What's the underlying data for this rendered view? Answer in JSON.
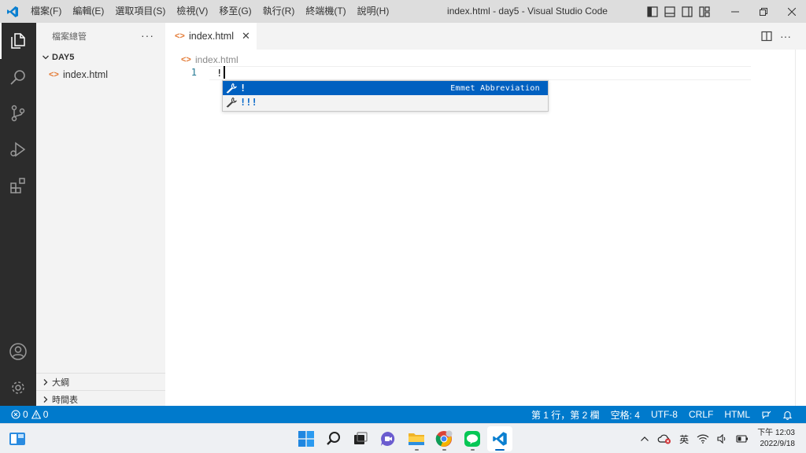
{
  "titlebar": {
    "menu": [
      "檔案(F)",
      "編輯(E)",
      "選取項目(S)",
      "檢視(V)",
      "移至(G)",
      "執行(R)",
      "終端機(T)",
      "說明(H)"
    ],
    "title": "index.html - day5 - Visual Studio Code",
    "accent": "#007acc"
  },
  "sidebar": {
    "header": "檔案總管",
    "more": "···",
    "folder": "DAY5",
    "files": [
      {
        "name": "index.html",
        "icon": "html-file-icon"
      }
    ],
    "outline": "大綱",
    "timeline": "時間表"
  },
  "tabs": [
    {
      "label": "index.html",
      "icon": "html-file-icon",
      "active": true
    }
  ],
  "editor": {
    "breadcrumb": "index.html",
    "line_number": "1",
    "code": "!"
  },
  "suggest": {
    "items": [
      {
        "label": "!",
        "detail": "Emmet Abbreviation",
        "selected": true,
        "icon": "wrench-icon"
      },
      {
        "label": "!!!",
        "detail": "",
        "selected": false,
        "icon": "wrench-icon"
      }
    ],
    "selected_bg": "#0060c0"
  },
  "statusbar": {
    "errors": "0",
    "warnings": "0",
    "position": "第 1 行，第 2 欄",
    "spaces": "空格: 4",
    "encoding": "UTF-8",
    "eol": "CRLF",
    "language": "HTML",
    "bg": "#007acc"
  },
  "taskbar": {
    "input_method": "英",
    "time": "下午 12:03",
    "date": "2022/9/18"
  }
}
